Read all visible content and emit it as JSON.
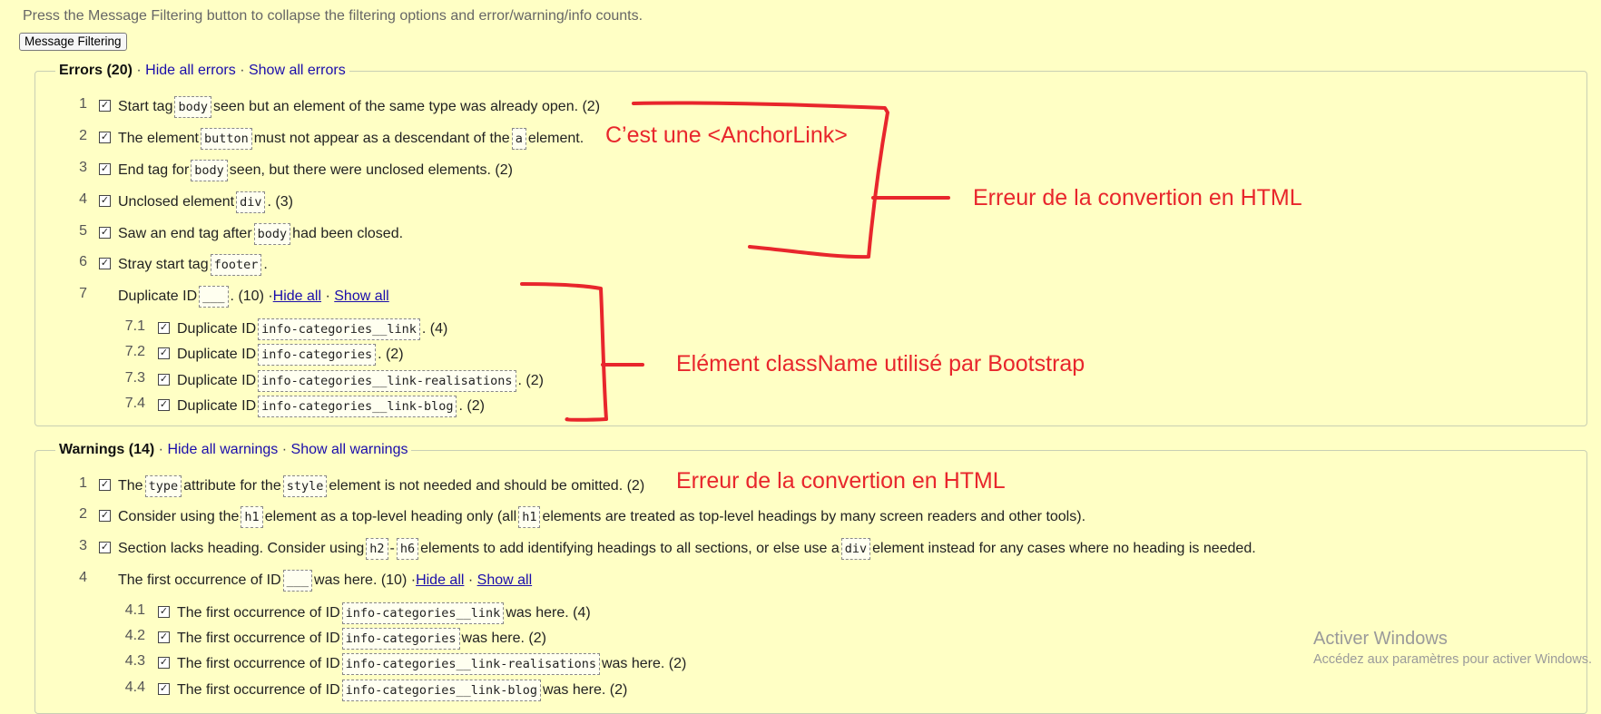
{
  "intro_text": "Press the Message Filtering button to collapse the filtering options and error/warning/info counts.",
  "filter_button_label": "Message Filtering",
  "errors": {
    "title": "Errors (20)",
    "hide_link": "Hide all errors",
    "show_link": "Show all errors",
    "items": [
      {
        "num": "1",
        "parts": [
          "Start tag ",
          "`body",
          " seen but an element of the same type was already open. (2)"
        ]
      },
      {
        "num": "2",
        "parts": [
          "The element ",
          "`button",
          " must not appear as a descendant of the ",
          "`a",
          " element."
        ]
      },
      {
        "num": "3",
        "parts": [
          "End tag for ",
          "`body",
          " seen, but there were unclosed elements. (2)"
        ]
      },
      {
        "num": "4",
        "parts": [
          "Unclosed element ",
          "`div",
          ". (3)"
        ]
      },
      {
        "num": "5",
        "parts": [
          "Saw an end tag after ",
          "`body",
          " had been closed."
        ]
      },
      {
        "num": "6",
        "parts": [
          "Stray start tag ",
          "`footer",
          "."
        ]
      }
    ],
    "group": {
      "num": "7",
      "prefix": "Duplicate ID ",
      "blank": "___",
      "suffix": ". (10) · ",
      "hide_all": "Hide all",
      "separator": " · ",
      "show_all": "Show all",
      "subitems": [
        {
          "num": "7.1",
          "prefix": "Duplicate ID ",
          "code": "info-categories__link",
          "suffix": ". (4)"
        },
        {
          "num": "7.2",
          "prefix": "Duplicate ID ",
          "code": "info-categories",
          "suffix": ". (2)"
        },
        {
          "num": "7.3",
          "prefix": "Duplicate ID ",
          "code": "info-categories__link-realisations",
          "suffix": ". (2)"
        },
        {
          "num": "7.4",
          "prefix": "Duplicate ID ",
          "code": "info-categories__link-blog",
          "suffix": ". (2)"
        }
      ]
    }
  },
  "warnings": {
    "title": "Warnings (14)",
    "hide_link": "Hide all warnings",
    "show_link": "Show all warnings",
    "items": [
      {
        "num": "1",
        "parts": [
          "The ",
          "`type",
          " attribute for the ",
          "`style",
          " element is not needed and should be omitted. (2)"
        ]
      },
      {
        "num": "2",
        "parts": [
          "Consider using the ",
          "`h1",
          " element as a top-level heading only (all ",
          "`h1",
          " elements are treated as top-level headings by many screen readers and other tools)."
        ]
      },
      {
        "num": "3",
        "parts": [
          "Section lacks heading. Consider using ",
          "`h2",
          "-",
          "`h6",
          " elements to add identifying headings to all sections, or else use a ",
          "`div",
          " element instead for any cases where no heading is needed."
        ]
      }
    ],
    "group": {
      "num": "4",
      "prefix": "The first occurrence of ID ",
      "blank": "___",
      "suffix": " was here. (10) · ",
      "hide_all": "Hide all",
      "separator": " · ",
      "show_all": "Show all",
      "subitems": [
        {
          "num": "4.1",
          "prefix": "The first occurrence of ID ",
          "code": "info-categories__link",
          "suffix": " was here. (4)"
        },
        {
          "num": "4.2",
          "prefix": "The first occurrence of ID ",
          "code": "info-categories",
          "suffix": " was here. (2)"
        },
        {
          "num": "4.3",
          "prefix": "The first occurrence of ID ",
          "code": "info-categories__link-realisations",
          "suffix": " was here. (2)"
        },
        {
          "num": "4.4",
          "prefix": "The first occurrence of ID ",
          "code": "info-categories__link-blog",
          "suffix": " was here. (2)"
        }
      ]
    }
  },
  "annotations": {
    "anchor_note": "C’est une <AnchorLink>",
    "conversion_note_1": "Erreur de la convertion en HTML",
    "bootstrap_note": "Elément className utilisé par Bootstrap",
    "conversion_note_2": "Erreur de la convertion en HTML",
    "color": "#e8262c"
  },
  "watermark": {
    "line1": "Activer Windows",
    "line2": "Accédez aux paramètres pour activer Windows."
  }
}
